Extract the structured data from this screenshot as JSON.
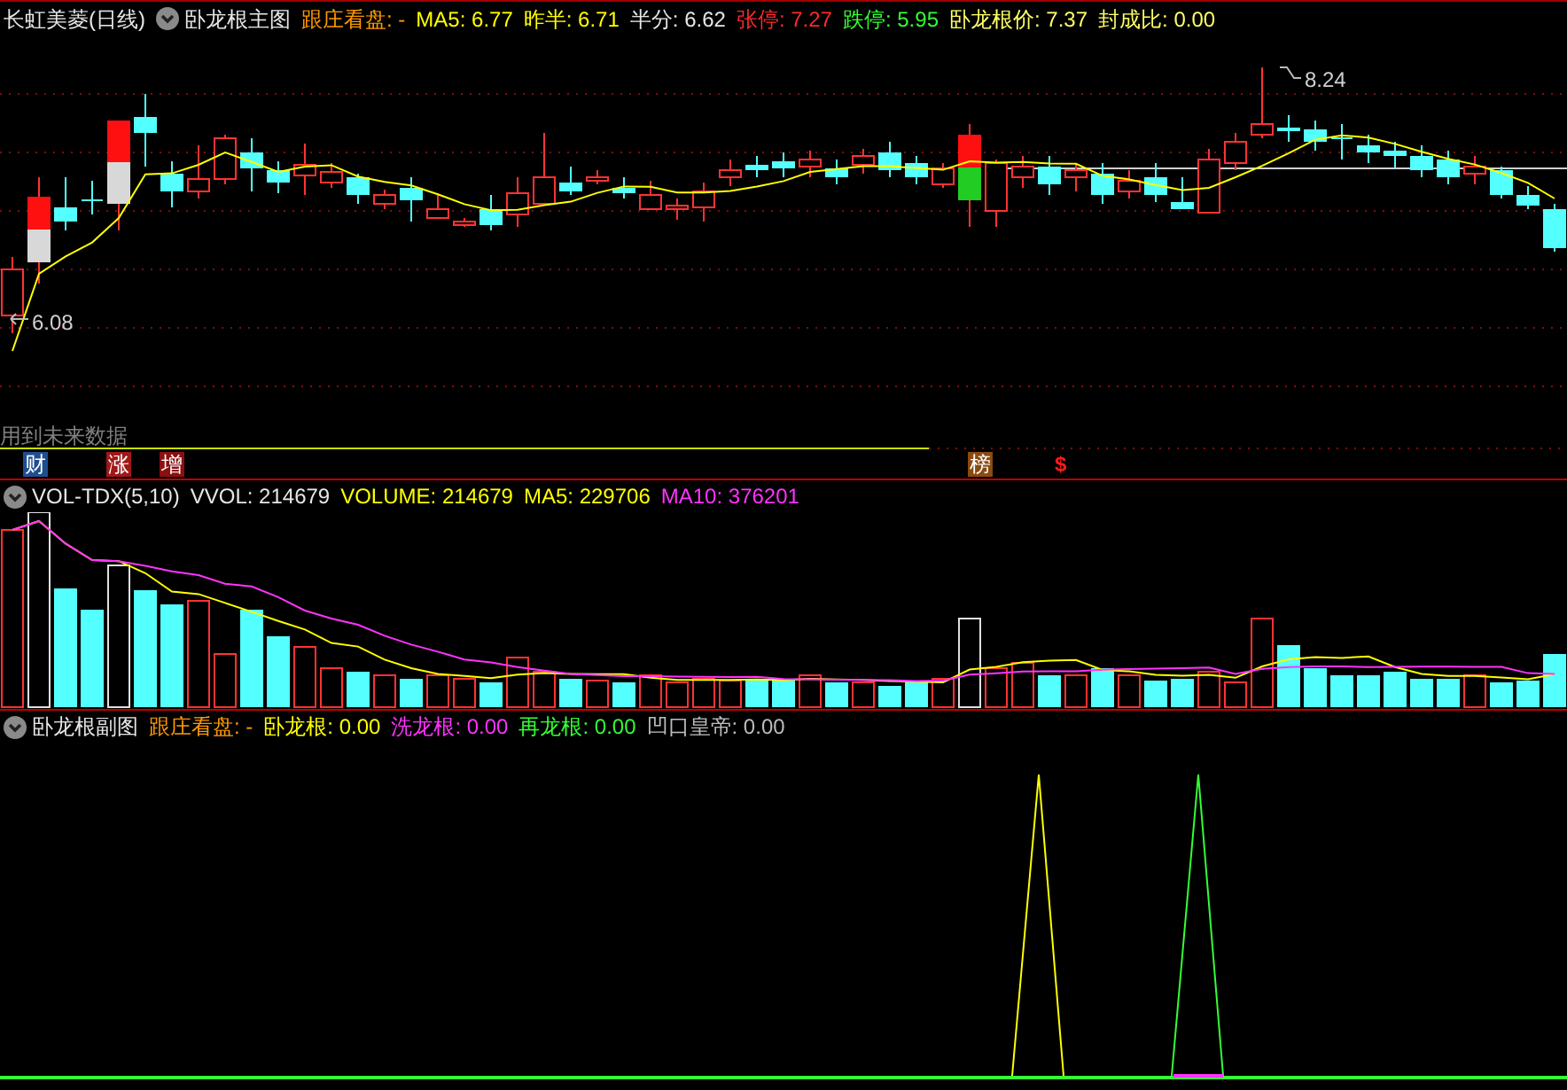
{
  "main_header": {
    "title": "长虹美菱(日线)",
    "indicator": "卧龙根主图",
    "readings": [
      {
        "text": "跟庄看盘: -",
        "color": "#ff9900"
      },
      {
        "text": "MA5: 6.77",
        "color": "#ffff00"
      },
      {
        "text": "昨半: 6.71",
        "color": "#ffff00"
      },
      {
        "text": "半分: 6.62",
        "color": "#e6e6e6"
      },
      {
        "text": "张停: 7.27",
        "color": "#ff2a2a"
      },
      {
        "text": "跌停: 5.95",
        "color": "#33ff33"
      },
      {
        "text": "卧龙根价: 7.37",
        "color": "#ffff66"
      },
      {
        "text": "封成比: 0.00",
        "color": "#ffff66"
      }
    ]
  },
  "main_chart": {
    "high_label": "8.24",
    "low_label": "6.08",
    "note": "用到未来数据",
    "markers": [
      {
        "label": "财",
        "color": "#1f4e8f"
      },
      {
        "label": "涨",
        "color": "#a01818"
      },
      {
        "label": "增",
        "color": "#8a1010"
      },
      {
        "label": "榜",
        "color": "#8a4a10"
      },
      {
        "label": "$",
        "color": "#ff1a1a"
      }
    ]
  },
  "volume_header": {
    "indicator": "VOL-TDX(5,10)",
    "readings": [
      {
        "text": "VVOL: 214679",
        "color": "#e6e6e6"
      },
      {
        "text": "VOLUME: 214679",
        "color": "#ffff00"
      },
      {
        "text": "MA5: 229706",
        "color": "#ffff00"
      },
      {
        "text": "MA10: 376201",
        "color": "#ff33ff"
      }
    ]
  },
  "sub_header": {
    "indicator": "卧龙根副图",
    "readings": [
      {
        "text": "跟庄看盘: -",
        "color": "#ff9900"
      },
      {
        "text": "卧龙根: 0.00",
        "color": "#ffff00"
      },
      {
        "text": "洗龙根: 0.00",
        "color": "#ff33ff"
      },
      {
        "text": "再龙根: 0.00",
        "color": "#33ff33"
      },
      {
        "text": "凹口皇帝: 0.00",
        "color": "#bdbdbd"
      }
    ]
  }
}
